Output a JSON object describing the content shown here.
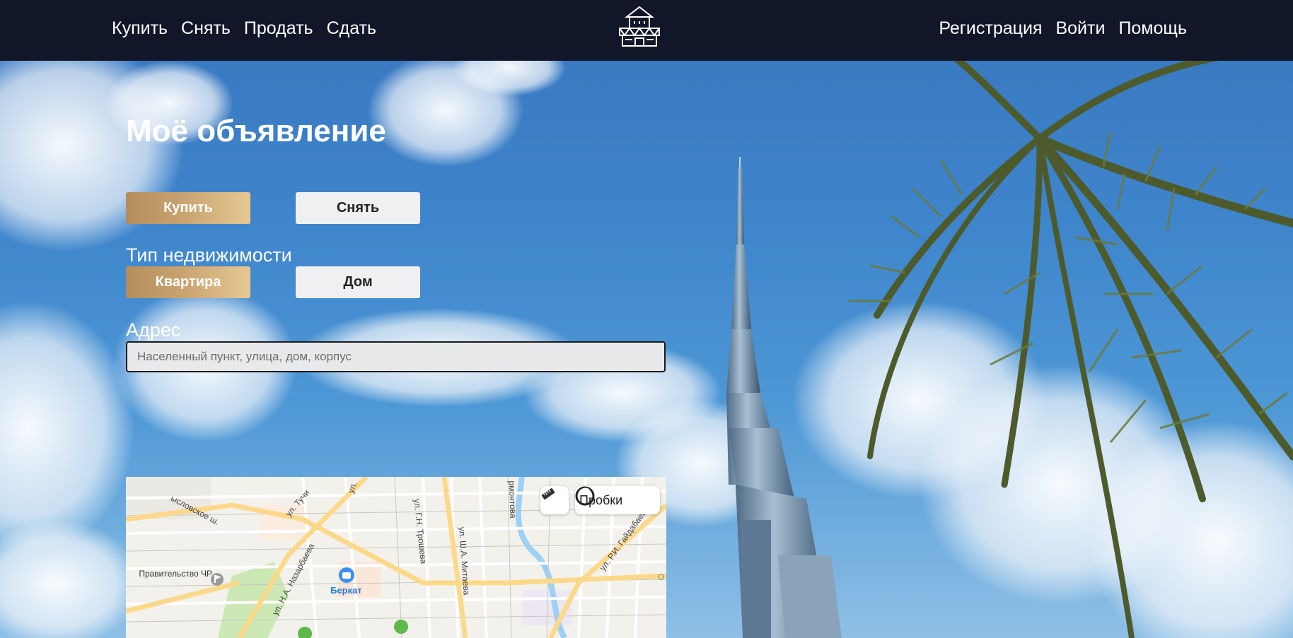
{
  "header": {
    "nav_left": [
      "Купить",
      "Снять",
      "Продать",
      "Сдать"
    ],
    "nav_right": [
      "Регистрация",
      "Войти",
      "Помощь"
    ],
    "logo_icon": "house-shop-icon"
  },
  "form": {
    "title": "Моё объявление",
    "deal_type": {
      "buy": "Купить",
      "rent": "Снять",
      "selected": "Купить"
    },
    "property_label": "Тип недвижимости",
    "property_type": {
      "flat": "Квартира",
      "house": "Дом",
      "selected": "Квартира"
    },
    "address_label": "Адрес",
    "address_placeholder": "Населенный пункт, улица, дом, корпус",
    "address_value": ""
  },
  "map": {
    "traffic_label": "Пробки",
    "ruler_icon": "ruler-icon",
    "traffic_icon": "traffic-light-icon",
    "streets": [
      "ысловское ш.",
      "ул. Тучи",
      "ул. Г.Н. Трошева",
      "ул. Ш.А. Митаева",
      "ул. Н.А. Назарбаева",
      "ул. Р.И. Гайдабаева",
      "рмонтова",
      "ул."
    ],
    "places": [
      {
        "name": "Правительство ЧР",
        "icon": "flag-icon"
      },
      {
        "name": "Беркат",
        "icon": "shopping-bag-icon"
      }
    ],
    "edge_text": "О"
  },
  "colors": {
    "header_bg": "#111629",
    "accent_gold": "#c9a36f",
    "idle_button": "#f0f0f2"
  }
}
